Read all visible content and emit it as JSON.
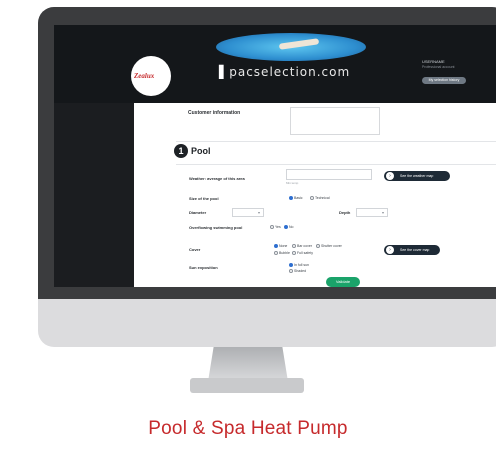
{
  "caption": "Pool & Spa Heat Pump",
  "header": {
    "brand_logo": "Zealux",
    "site_name": "pacselection.com",
    "user_name": "USERNAME",
    "user_subtitle": "Professional account",
    "user_button": "My selection history"
  },
  "form": {
    "customer_info_label": "Customer information",
    "section": {
      "number": "1",
      "title": "Pool"
    },
    "weather_label": "Weather: average of this area",
    "weather_sublabel": "Min temp",
    "weather_map_button": "See the weather map",
    "size_label": "Size of the pool",
    "size_options": [
      "Basic",
      "Technical"
    ],
    "size_selected": 0,
    "diameter_label": "Diameter",
    "depth_label": "Depth",
    "overflow_label": "Overflowing swimming pool",
    "overflow_options": [
      "Yes",
      "No"
    ],
    "overflow_selected": 1,
    "cover_label": "Cover",
    "cover_options": [
      "None",
      "Bar cover",
      "Shutter cover",
      "Bubble",
      "Full safety"
    ],
    "cover_selected": 0,
    "cover_map_button": "See the cover map",
    "exposure_label": "Sun exposition",
    "exposure_options": [
      "In full sun",
      "Shaded"
    ],
    "exposure_selected": 0,
    "validate_button": "Validate"
  },
  "colors": {
    "caption": "#c62a2c",
    "validate": "#1aa36a",
    "pill": "#1e2a36"
  }
}
